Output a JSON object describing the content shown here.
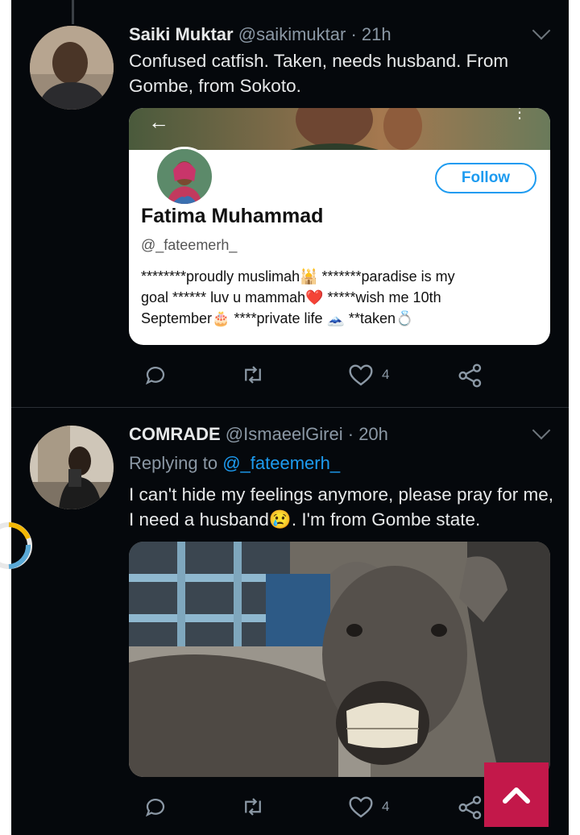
{
  "tweets": [
    {
      "display_name": "Saiki Muktar",
      "handle": "@saikimuktar",
      "time": "· 21h",
      "text": "Confused catfish. Taken, needs husband. From Gombe, from Sokoto.",
      "card": {
        "name": "Fatima Muhammad",
        "handle": "@_fateemerh_",
        "follow_label": "Follow",
        "bio_lines": [
          "********proudly muslimah🕌 *******paradise is my",
          "goal ****** luv u mammah❤️ *****wish me 10th",
          "September🎂 ****private life 🗻 **taken💍"
        ]
      },
      "actions": {
        "reply_count": "",
        "retweet_count": "",
        "like_count": "4"
      }
    },
    {
      "display_name": "COMRADE",
      "handle": "@IsmaeelGirei",
      "time": "· 20h",
      "reply_prefix": "Replying to",
      "reply_to": "@_fateemerh_",
      "text": "I can't hide my feelings anymore, please pray for me, I need a husband😢. I'm from Gombe state.",
      "media_alt": "laughing donkey",
      "actions": {
        "reply_count": "",
        "retweet_count": "",
        "like_count": "4"
      }
    }
  ],
  "icons": {
    "reply": "reply-icon",
    "retweet": "retweet-icon",
    "like": "heart-icon",
    "share": "share-icon",
    "caret": "chevron-down-icon",
    "scroll_top": "chevron-up-icon"
  },
  "colors": {
    "background": "#05080c",
    "accent": "#1d9bf0",
    "scroll_button": "#c3184a"
  }
}
